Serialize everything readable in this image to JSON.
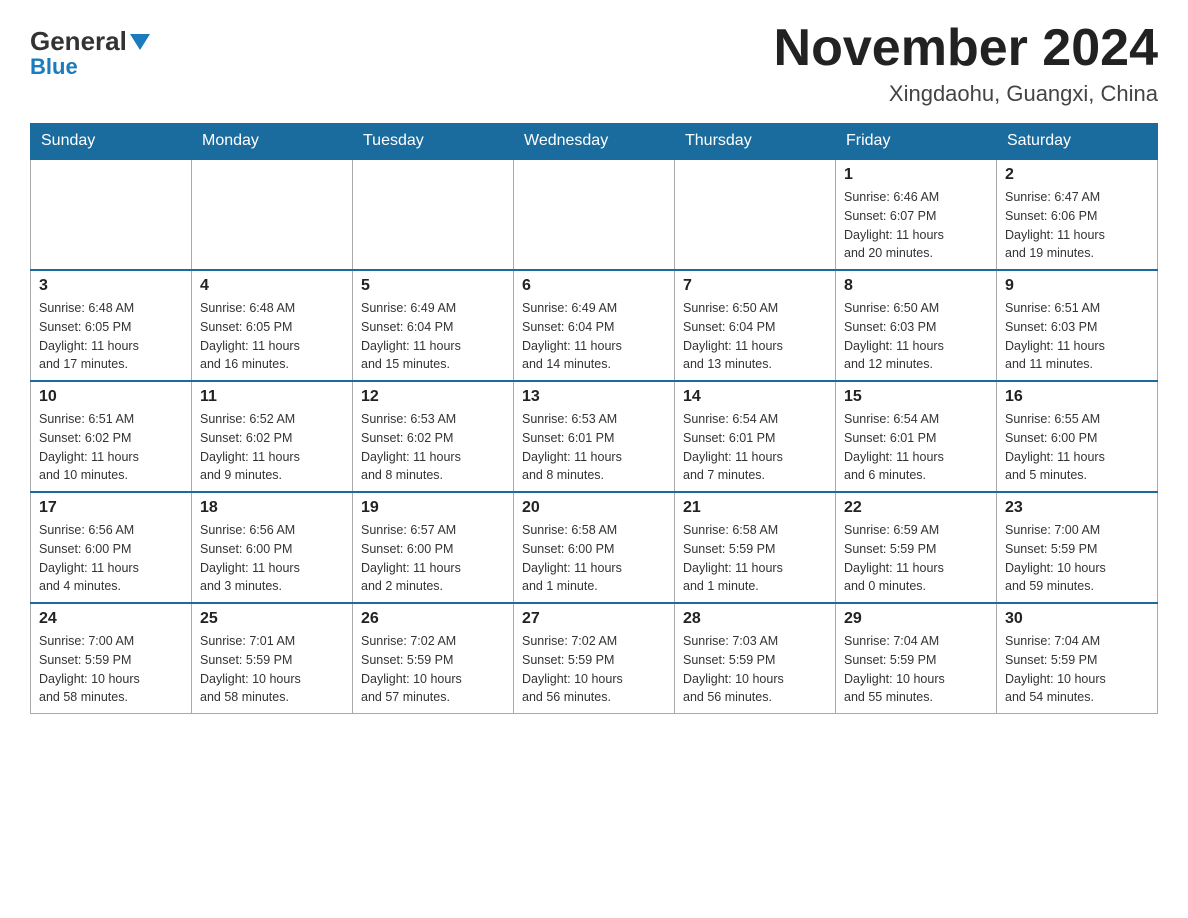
{
  "header": {
    "logo": {
      "general": "General",
      "blue": "Blue"
    },
    "title": "November 2024",
    "location": "Xingdaohu, Guangxi, China"
  },
  "calendar": {
    "days_of_week": [
      "Sunday",
      "Monday",
      "Tuesday",
      "Wednesday",
      "Thursday",
      "Friday",
      "Saturday"
    ],
    "weeks": [
      [
        {
          "day": "",
          "info": ""
        },
        {
          "day": "",
          "info": ""
        },
        {
          "day": "",
          "info": ""
        },
        {
          "day": "",
          "info": ""
        },
        {
          "day": "",
          "info": ""
        },
        {
          "day": "1",
          "info": "Sunrise: 6:46 AM\nSunset: 6:07 PM\nDaylight: 11 hours\nand 20 minutes."
        },
        {
          "day": "2",
          "info": "Sunrise: 6:47 AM\nSunset: 6:06 PM\nDaylight: 11 hours\nand 19 minutes."
        }
      ],
      [
        {
          "day": "3",
          "info": "Sunrise: 6:48 AM\nSunset: 6:05 PM\nDaylight: 11 hours\nand 17 minutes."
        },
        {
          "day": "4",
          "info": "Sunrise: 6:48 AM\nSunset: 6:05 PM\nDaylight: 11 hours\nand 16 minutes."
        },
        {
          "day": "5",
          "info": "Sunrise: 6:49 AM\nSunset: 6:04 PM\nDaylight: 11 hours\nand 15 minutes."
        },
        {
          "day": "6",
          "info": "Sunrise: 6:49 AM\nSunset: 6:04 PM\nDaylight: 11 hours\nand 14 minutes."
        },
        {
          "day": "7",
          "info": "Sunrise: 6:50 AM\nSunset: 6:04 PM\nDaylight: 11 hours\nand 13 minutes."
        },
        {
          "day": "8",
          "info": "Sunrise: 6:50 AM\nSunset: 6:03 PM\nDaylight: 11 hours\nand 12 minutes."
        },
        {
          "day": "9",
          "info": "Sunrise: 6:51 AM\nSunset: 6:03 PM\nDaylight: 11 hours\nand 11 minutes."
        }
      ],
      [
        {
          "day": "10",
          "info": "Sunrise: 6:51 AM\nSunset: 6:02 PM\nDaylight: 11 hours\nand 10 minutes."
        },
        {
          "day": "11",
          "info": "Sunrise: 6:52 AM\nSunset: 6:02 PM\nDaylight: 11 hours\nand 9 minutes."
        },
        {
          "day": "12",
          "info": "Sunrise: 6:53 AM\nSunset: 6:02 PM\nDaylight: 11 hours\nand 8 minutes."
        },
        {
          "day": "13",
          "info": "Sunrise: 6:53 AM\nSunset: 6:01 PM\nDaylight: 11 hours\nand 8 minutes."
        },
        {
          "day": "14",
          "info": "Sunrise: 6:54 AM\nSunset: 6:01 PM\nDaylight: 11 hours\nand 7 minutes."
        },
        {
          "day": "15",
          "info": "Sunrise: 6:54 AM\nSunset: 6:01 PM\nDaylight: 11 hours\nand 6 minutes."
        },
        {
          "day": "16",
          "info": "Sunrise: 6:55 AM\nSunset: 6:00 PM\nDaylight: 11 hours\nand 5 minutes."
        }
      ],
      [
        {
          "day": "17",
          "info": "Sunrise: 6:56 AM\nSunset: 6:00 PM\nDaylight: 11 hours\nand 4 minutes."
        },
        {
          "day": "18",
          "info": "Sunrise: 6:56 AM\nSunset: 6:00 PM\nDaylight: 11 hours\nand 3 minutes."
        },
        {
          "day": "19",
          "info": "Sunrise: 6:57 AM\nSunset: 6:00 PM\nDaylight: 11 hours\nand 2 minutes."
        },
        {
          "day": "20",
          "info": "Sunrise: 6:58 AM\nSunset: 6:00 PM\nDaylight: 11 hours\nand 1 minute."
        },
        {
          "day": "21",
          "info": "Sunrise: 6:58 AM\nSunset: 5:59 PM\nDaylight: 11 hours\nand 1 minute."
        },
        {
          "day": "22",
          "info": "Sunrise: 6:59 AM\nSunset: 5:59 PM\nDaylight: 11 hours\nand 0 minutes."
        },
        {
          "day": "23",
          "info": "Sunrise: 7:00 AM\nSunset: 5:59 PM\nDaylight: 10 hours\nand 59 minutes."
        }
      ],
      [
        {
          "day": "24",
          "info": "Sunrise: 7:00 AM\nSunset: 5:59 PM\nDaylight: 10 hours\nand 58 minutes."
        },
        {
          "day": "25",
          "info": "Sunrise: 7:01 AM\nSunset: 5:59 PM\nDaylight: 10 hours\nand 58 minutes."
        },
        {
          "day": "26",
          "info": "Sunrise: 7:02 AM\nSunset: 5:59 PM\nDaylight: 10 hours\nand 57 minutes."
        },
        {
          "day": "27",
          "info": "Sunrise: 7:02 AM\nSunset: 5:59 PM\nDaylight: 10 hours\nand 56 minutes."
        },
        {
          "day": "28",
          "info": "Sunrise: 7:03 AM\nSunset: 5:59 PM\nDaylight: 10 hours\nand 56 minutes."
        },
        {
          "day": "29",
          "info": "Sunrise: 7:04 AM\nSunset: 5:59 PM\nDaylight: 10 hours\nand 55 minutes."
        },
        {
          "day": "30",
          "info": "Sunrise: 7:04 AM\nSunset: 5:59 PM\nDaylight: 10 hours\nand 54 minutes."
        }
      ]
    ]
  }
}
